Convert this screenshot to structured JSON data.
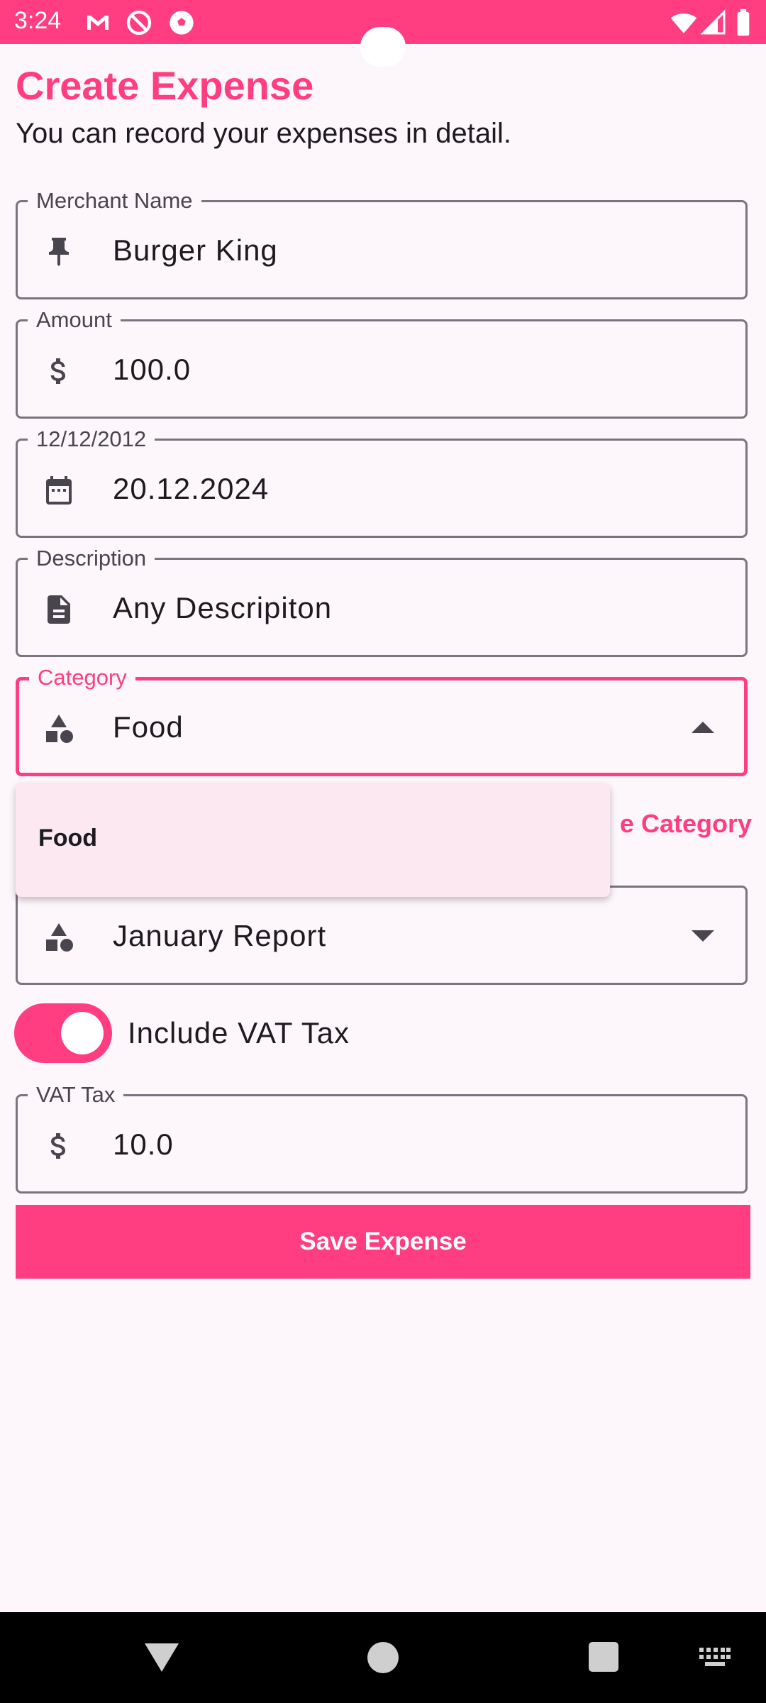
{
  "status_bar": {
    "time": "3:24",
    "notification_icons": [
      "gmail-icon",
      "do-not-disturb-icon",
      "soccer-ball-icon"
    ],
    "system_icons": [
      "wifi-icon",
      "signal-icon",
      "battery-icon"
    ]
  },
  "header": {
    "title": "Create Expense",
    "subtitle": "You can record your expenses in detail."
  },
  "fields": {
    "merchant": {
      "label": "Merchant Name",
      "value": "Burger King",
      "icon": "pin-icon"
    },
    "amount": {
      "label": "Amount",
      "value": "100.0",
      "icon": "dollar-icon"
    },
    "date": {
      "label": "12/12/2012",
      "value": "20.12.2024",
      "icon": "calendar-icon"
    },
    "description": {
      "label": "Description",
      "value": "Any Descripiton",
      "icon": "document-icon"
    },
    "category": {
      "label": "Category",
      "value": "Food",
      "icon": "category-icon",
      "expanded": true
    },
    "report": {
      "value": "January Report",
      "icon": "category-icon"
    },
    "vat": {
      "label": "VAT Tax",
      "value": "10.0",
      "icon": "dollar-icon"
    }
  },
  "category_menu": {
    "items": [
      "Food"
    ]
  },
  "create_category_link": "e Category",
  "vat_switch": {
    "label": "Include VAT Tax",
    "checked": true
  },
  "save_button": "Save Expense",
  "colors": {
    "accent": "#ff3d80",
    "background": "#fdf7fb",
    "menu_background": "#fbe8f1",
    "outline": "#79747e"
  }
}
